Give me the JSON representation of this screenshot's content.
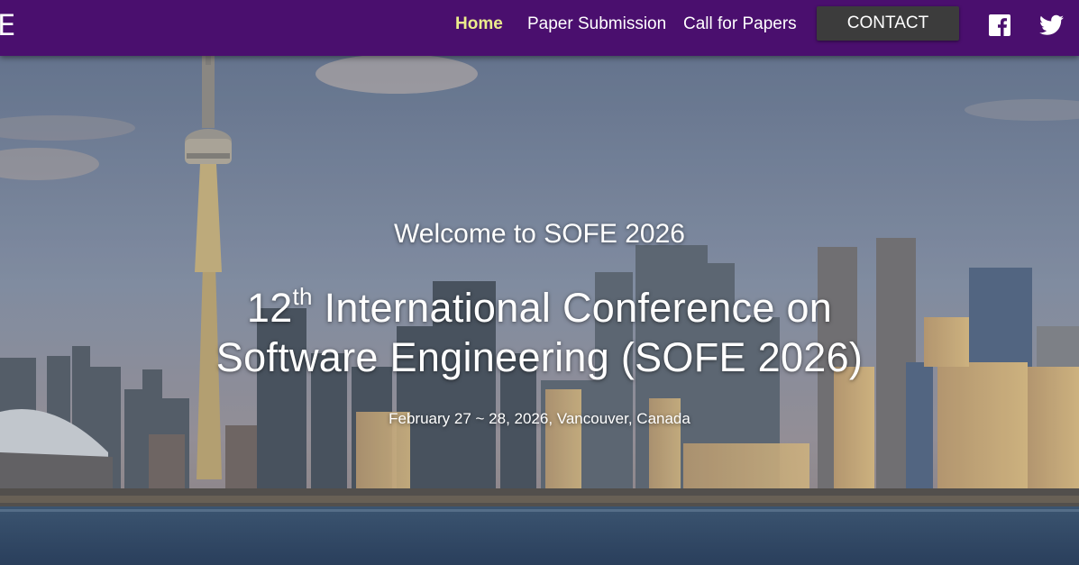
{
  "brand": {
    "text": "E"
  },
  "nav": {
    "items": [
      {
        "label": "Home",
        "active": true
      },
      {
        "label": "Paper Submission",
        "active": false
      },
      {
        "label": "Call for Papers",
        "active": false
      }
    ],
    "contact_label": "CONTACT",
    "social": [
      "facebook-icon",
      "twitter-icon"
    ]
  },
  "hero": {
    "welcome": "Welcome to SOFE 2026",
    "title_number": "12",
    "title_suffix": "th",
    "title_line1_rest": " International Conference on",
    "title_line2": "Software Engineering (SOFE 2026)",
    "dateline": "February 27 ~ 28, 2026, Vancouver, Canada"
  },
  "colors": {
    "navbar": "#4a0f6e",
    "active_link": "#ecec8c",
    "contact_button": "#3c3c3c"
  }
}
